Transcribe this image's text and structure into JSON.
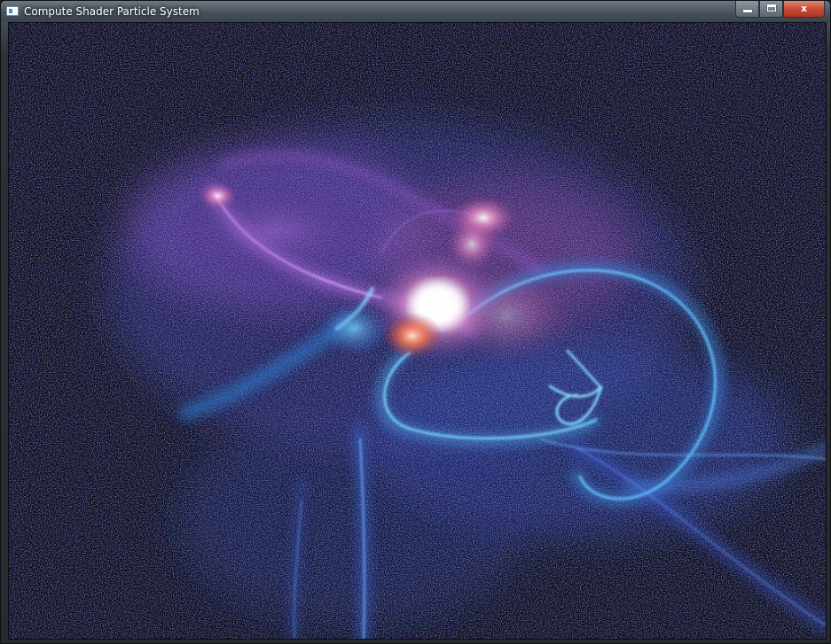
{
  "window": {
    "title": "Compute Shader Particle System",
    "icon": "app-window-icon",
    "buttons": {
      "minimize_icon": "minimize-icon",
      "maximize_icon": "maximize-icon",
      "close_label": "x"
    }
  },
  "colors": {
    "background": "#06060e",
    "glow_core": "#ffffff",
    "glow_pink": "#f070c0",
    "glow_orange": "#ff8a50",
    "trail_cyan": "#52b8f0",
    "trail_blue": "#4a6ad8",
    "haze_violet": "#7a4ab0",
    "noise_blue": "#5a5cc8"
  }
}
